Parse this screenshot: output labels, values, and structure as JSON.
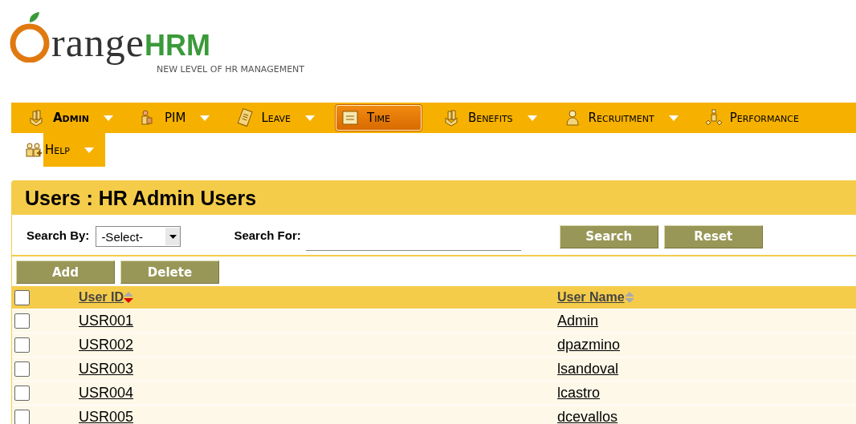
{
  "logo": {
    "wordmark": "range",
    "brand": "HRM",
    "tagline": "NEW LEVEL OF HR MANAGEMENT"
  },
  "menu": [
    {
      "label": "Admin",
      "selected": false,
      "has_dropdown": true,
      "bold": true
    },
    {
      "label": "PIM",
      "selected": false,
      "has_dropdown": true,
      "bold": false
    },
    {
      "label": "Leave",
      "selected": false,
      "has_dropdown": true,
      "bold": false
    },
    {
      "label": "Time",
      "selected": true,
      "has_dropdown": false,
      "bold": false
    },
    {
      "label": "Benefits",
      "selected": false,
      "has_dropdown": true,
      "bold": false
    },
    {
      "label": "Recruitment",
      "selected": false,
      "has_dropdown": true,
      "bold": false
    },
    {
      "label": "Performance",
      "selected": false,
      "has_dropdown": false,
      "bold": false
    },
    {
      "label": "Help",
      "selected": false,
      "has_dropdown": true,
      "bold": false
    }
  ],
  "panel": {
    "title": "Users : HR Admin Users",
    "search_by": {
      "label": "Search By:",
      "value": "-Select-"
    },
    "search_for": {
      "label": "Search For:"
    },
    "search_buttons": [
      "Search",
      "Reset"
    ],
    "action_buttons": [
      "Add",
      "Delete"
    ]
  },
  "table": {
    "select_all": {
      "checked": false
    },
    "columns": [
      {
        "label": "User ID",
        "sorted": true
      },
      {
        "label": "User Name",
        "sorted": false
      }
    ],
    "rows": [
      {
        "checked": false,
        "user_id": "USR001",
        "user_name": "Admin"
      },
      {
        "checked": false,
        "user_id": "USR002",
        "user_name": "dpazmino"
      },
      {
        "checked": false,
        "user_id": "USR003",
        "user_name": "lsandoval"
      },
      {
        "checked": false,
        "user_id": "USR004",
        "user_name": "lcastro"
      },
      {
        "checked": false,
        "user_id": "USR005",
        "user_name": "dcevallos"
      }
    ]
  }
}
